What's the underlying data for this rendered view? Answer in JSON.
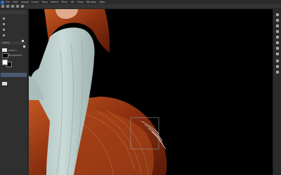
{
  "app": {
    "accent": "#1f6fd1",
    "canvas_bg": "#000000"
  },
  "menu": {
    "items": [
      "File",
      "Edit",
      "Image",
      "Layer",
      "Type",
      "Select",
      "Filter",
      "3D",
      "View",
      "Window",
      "Help"
    ]
  },
  "layers_panel": {
    "tab_label": "Layers",
    "rows": [
      {
        "name": "Layer 1"
      },
      {
        "name": "Background"
      }
    ]
  },
  "tools": {
    "icons": [
      "move-icon",
      "marquee-icon",
      "lasso-icon",
      "quick-select-icon",
      "crop-icon",
      "eyedropper-icon",
      "healing-icon",
      "brush-icon",
      "stamp-icon",
      "history-brush-icon",
      "eraser-icon",
      "gradient-icon",
      "blur-icon",
      "dodge-icon",
      "pen-icon",
      "type-icon",
      "path-select-icon",
      "shape-icon",
      "hand-icon",
      "zoom-icon"
    ]
  },
  "colors": {
    "foreground": "#ffffff",
    "background": "#000000"
  }
}
